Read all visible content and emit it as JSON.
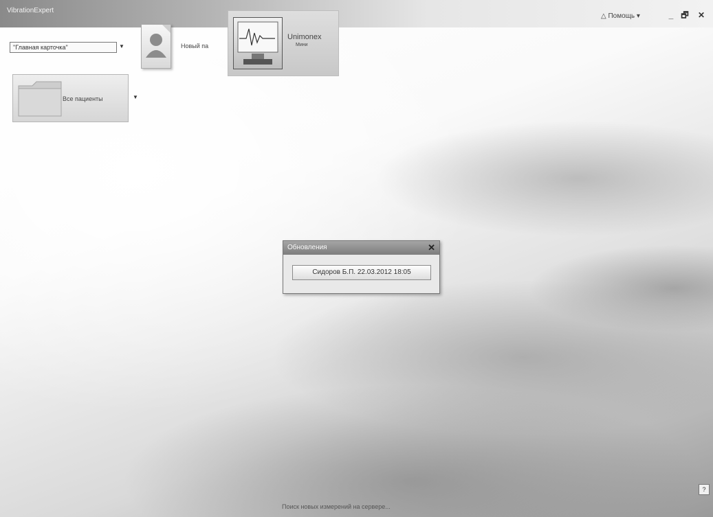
{
  "window": {
    "title": "VibrationExpert",
    "help_label": "Помощь",
    "minimize_glyph": "_",
    "restore_glyph": "🗗",
    "close_glyph": "✕"
  },
  "toolbar": {
    "card_dropdown_value": "\"Главная карточка\"",
    "new_patient_label": "Новый па",
    "unimonex_title": "Unimonex",
    "unimonex_subtitle": "Мини",
    "all_patients_label": "Все пациенты"
  },
  "dialog": {
    "title": "Обновления",
    "close_glyph": "✕",
    "item_label": "Сидоров Б.П. 22.03.2012 18:05"
  },
  "status": {
    "text": "Поиск новых измерений на сервере..."
  },
  "corner": {
    "glyph": "?"
  },
  "icons": {
    "dropdown": "chevron-down-icon",
    "patient": "user-icon",
    "monitor": "monitor-icon",
    "folder": "folder-icon"
  }
}
